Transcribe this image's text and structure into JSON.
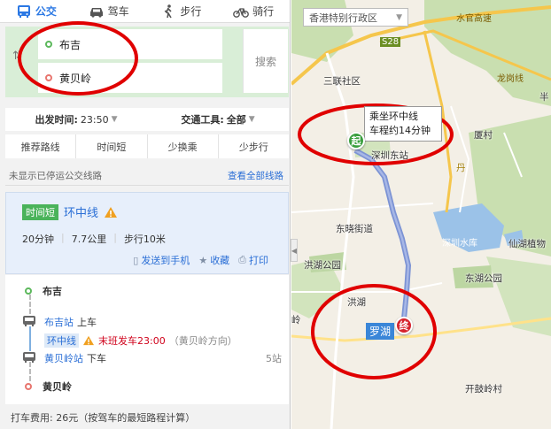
{
  "modes": [
    {
      "label": "公交",
      "icon": "bus-icon",
      "active": true
    },
    {
      "label": "驾车",
      "icon": "car-icon",
      "active": false
    },
    {
      "label": "步行",
      "icon": "walk-icon",
      "active": false
    },
    {
      "label": "骑行",
      "icon": "bike-icon",
      "active": false
    }
  ],
  "route": {
    "from": "布吉",
    "to": "黄贝岭",
    "search_label": "搜索"
  },
  "filters": {
    "depart_label": "出发时间:",
    "depart_value": "23:50",
    "tool_label": "交通工具:",
    "tool_value": "全部"
  },
  "sorts": [
    "推荐路线",
    "时间短",
    "少换乘",
    "少步行"
  ],
  "notice": {
    "text": "未显示已停运公交线路",
    "link": "查看全部线路"
  },
  "plan": {
    "tag": "时间短",
    "line": "环中线",
    "duration": "20分钟",
    "distance": "7.7公里",
    "walk": "步行10米",
    "send_to_phone": "发送到手机",
    "favorite": "收藏",
    "print": "打印"
  },
  "detail": {
    "start": "布吉",
    "board_station": "布吉站",
    "board_action": "上车",
    "line_chip": "环中线",
    "last_bus": "末班发车23:00",
    "direction": "（黄贝岭方向）",
    "alight_station": "黄贝岭站",
    "alight_action": "下车",
    "stops": "5站",
    "end": "黄贝岭"
  },
  "fare": "打车费用: 26元（按驾车的最短路程计算）",
  "map": {
    "region": "香港特别行政区",
    "tooltip_line1": "乘坐环中线",
    "tooltip_line2": "车程约14分钟",
    "start_pin": "起",
    "end_pin": "终",
    "labels": {
      "water_road": "水官高速",
      "s28": "S28",
      "longgang": "龙岗线",
      "sanlian": "三联社区",
      "shenzhen_east": "深圳东站",
      "xiamei": "厦村",
      "dongxiao": "东晓街道",
      "reservoir": "深圳水库",
      "xianhu": "仙湖植物",
      "hongshan": "洪湖公园",
      "donghu": "东湖公园",
      "hongtu": "洪湖",
      "luohu": "罗湖",
      "ling": "岭",
      "shenxi": "深",
      "dyang": "丹",
      "jingu": "坪",
      "kaigu": "开鼓岭村",
      "ban": "半"
    }
  },
  "colors": {
    "accent": "#2b78e4",
    "route_line": "#7c93d4",
    "route_box": "#d9eed7",
    "tag_green": "#4ab35a",
    "annotation_red": "#e00000"
  }
}
